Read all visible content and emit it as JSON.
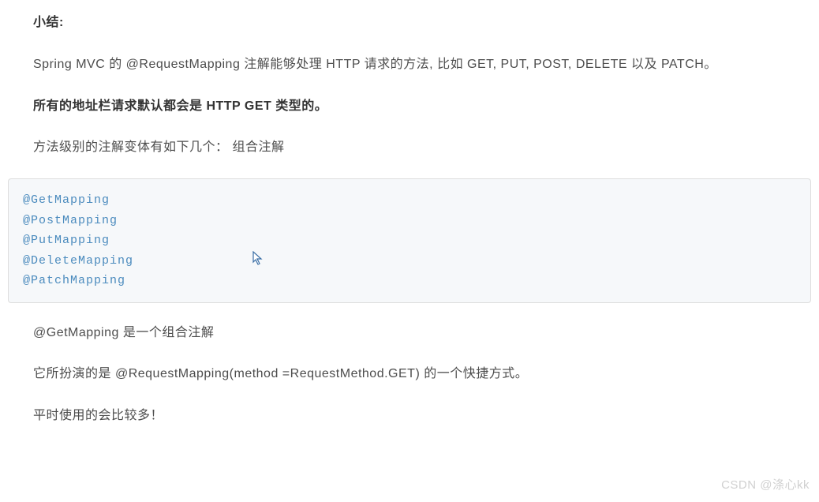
{
  "doc": {
    "heading": "小结:",
    "p1": "Spring MVC 的 @RequestMapping 注解能够处理 HTTP 请求的方法, 比如 GET, PUT, POST, DELETE 以及 PATCH。",
    "p2_bold": "所有的地址栏请求默认都会是 HTTP GET 类型的。",
    "p3": "方法级别的注解变体有如下几个：  组合注解",
    "code_lines": [
      "@GetMapping",
      "@PostMapping",
      "@PutMapping",
      "@DeleteMapping",
      "@PatchMapping"
    ],
    "p4": "@GetMapping 是一个组合注解",
    "p5": "它所扮演的是 @RequestMapping(method =RequestMethod.GET) 的一个快捷方式。",
    "p6": "平时使用的会比较多！",
    "watermark": "CSDN @涤心kk"
  }
}
